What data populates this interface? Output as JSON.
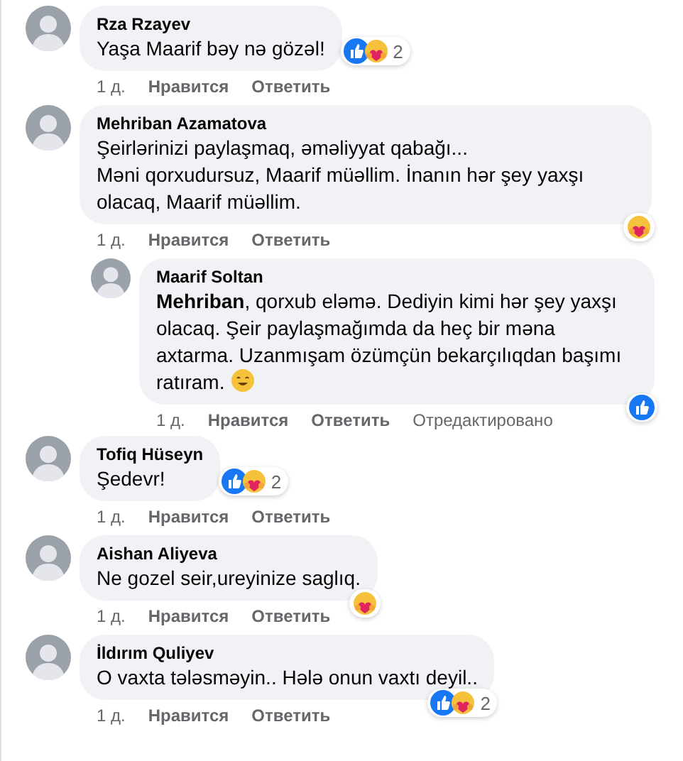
{
  "comments": [
    {
      "author": "Rza Rzayev",
      "text": "Yaşa Maarif bəy nə gözəl!",
      "reactions": {
        "types": [
          {
            "kind": "like"
          },
          {
            "kind": "care"
          }
        ],
        "count": "2"
      },
      "actions": {
        "time": "1 д.",
        "like": "Нравится",
        "reply": "Ответить"
      }
    },
    {
      "author": "Mehriban Azamatova",
      "text": "Şeirlərinizi paylaşmaq, əməliyyat qabağı...\nMəni qorxudursuz, Maarif müəllim. İnanın hər şey yaxşı olacaq, Maarif müəllim.",
      "reactions": {
        "types": [
          {
            "kind": "care"
          }
        ]
      },
      "actions": {
        "time": "1 д.",
        "like": "Нравится",
        "reply": "Ответить"
      },
      "replies": [
        {
          "author": "Maarif Soltan",
          "text": "**Mehriban**, qorxub eləmə. Dediyin kimi hər şey yaxşı olacaq. Şeir paylaşmağımda da heç bir məna axtarma. Uzanmışam özümçün bekarçılıqdan başımı ratıram.",
          "emoji": {
            "kind": "smile"
          },
          "reactions": {
            "types": [
              {
                "kind": "like"
              }
            ]
          },
          "actions": {
            "time": "1 д.",
            "like": "Нравится",
            "reply": "Ответить",
            "edited": "Отредактировано"
          }
        }
      ]
    },
    {
      "author": "Tofiq Hüseyn",
      "text": "Şedevr!",
      "reactions": {
        "types": [
          {
            "kind": "like"
          },
          {
            "kind": "care"
          }
        ],
        "count": "2"
      },
      "actions": {
        "time": "1 д.",
        "like": "Нравится",
        "reply": "Ответить"
      }
    },
    {
      "author": "Aishan Aliyeva",
      "text": "Ne gozel seir,ureyinize saglıq.",
      "reactions": {
        "types": [
          {
            "kind": "care"
          }
        ]
      },
      "actions": {
        "time": "1 д.",
        "like": "Нравится",
        "reply": "Ответить"
      }
    },
    {
      "author": "İldırım Quliyev",
      "text": "O vaxta tələsməyin.. Hələ onun vaxtı deyil..",
      "reactions": {
        "types": [
          {
            "kind": "like"
          },
          {
            "kind": "care"
          }
        ],
        "count": "2"
      },
      "actions": {
        "time": "1 д.",
        "like": "Нравится",
        "reply": "Ответить"
      }
    }
  ]
}
